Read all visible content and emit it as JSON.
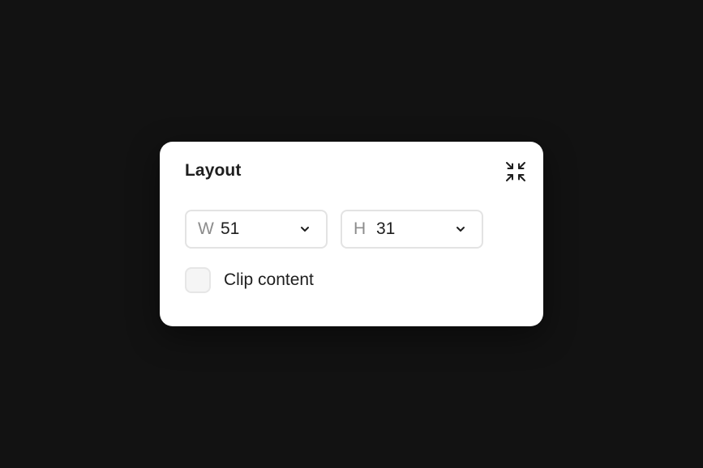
{
  "panel": {
    "title": "Layout",
    "collapse_icon": "collapse-icon"
  },
  "width_field": {
    "prefix": "W",
    "value": "51",
    "dropdown_icon": "chevron-down-icon"
  },
  "height_field": {
    "prefix": "H",
    "value": "31",
    "dropdown_icon": "chevron-down-icon"
  },
  "clip_content": {
    "label": "Clip content",
    "checked": false
  },
  "colors": {
    "background": "#121212",
    "panel": "#ffffff",
    "text": "#1e1e1e",
    "muted_text": "#8c8c8c",
    "border": "#e3e3e3"
  }
}
